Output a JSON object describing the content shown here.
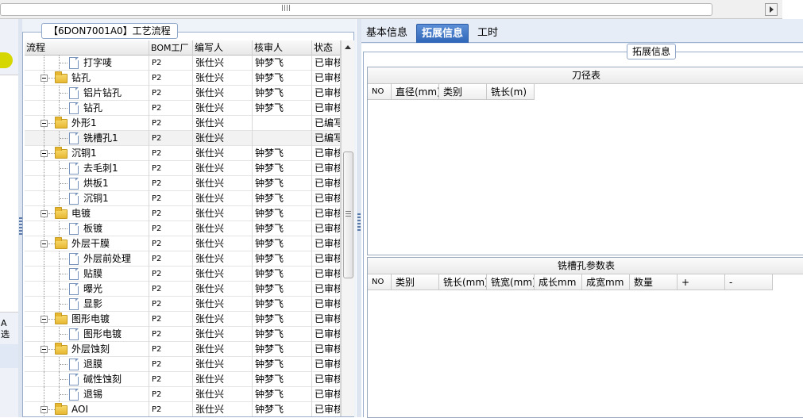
{
  "tree_panel": {
    "title": "【6DON7001A0】工艺流程",
    "columns": [
      "流程",
      "BOM工厂",
      "编写人",
      "核审人",
      "状态"
    ],
    "rows": [
      {
        "name": "打字唛",
        "level": 2,
        "node": "file",
        "bom": "P2",
        "writer": "张仕兴",
        "reviewer": "钟梦飞",
        "status": "已审核"
      },
      {
        "name": "钻孔",
        "level": 1,
        "node": "folder",
        "bom": "P2",
        "writer": "张仕兴",
        "reviewer": "钟梦飞",
        "status": "已审核"
      },
      {
        "name": "铝片钻孔",
        "level": 2,
        "node": "file",
        "bom": "P2",
        "writer": "张仕兴",
        "reviewer": "钟梦飞",
        "status": "已审核"
      },
      {
        "name": "钻孔",
        "level": 2,
        "node": "file",
        "bom": "P2",
        "writer": "张仕兴",
        "reviewer": "钟梦飞",
        "status": "已审核"
      },
      {
        "name": "外形1",
        "level": 1,
        "node": "folder",
        "bom": "P2",
        "writer": "张仕兴",
        "reviewer": "",
        "status": "已编写"
      },
      {
        "name": "铣槽孔1",
        "level": 2,
        "node": "file",
        "bom": "P2",
        "writer": "张仕兴",
        "reviewer": "",
        "status": "已编写",
        "selected": true
      },
      {
        "name": "沉铜1",
        "level": 1,
        "node": "folder",
        "bom": "P2",
        "writer": "张仕兴",
        "reviewer": "钟梦飞",
        "status": "已审核"
      },
      {
        "name": "去毛刺1",
        "level": 2,
        "node": "file",
        "bom": "P2",
        "writer": "张仕兴",
        "reviewer": "钟梦飞",
        "status": "已审核"
      },
      {
        "name": "烘板1",
        "level": 2,
        "node": "file",
        "bom": "P2",
        "writer": "张仕兴",
        "reviewer": "钟梦飞",
        "status": "已审核"
      },
      {
        "name": "沉铜1",
        "level": 2,
        "node": "file",
        "bom": "P2",
        "writer": "张仕兴",
        "reviewer": "钟梦飞",
        "status": "已审核"
      },
      {
        "name": "电镀",
        "level": 1,
        "node": "folder",
        "bom": "P2",
        "writer": "张仕兴",
        "reviewer": "钟梦飞",
        "status": "已审核"
      },
      {
        "name": "板镀",
        "level": 2,
        "node": "file",
        "bom": "P2",
        "writer": "张仕兴",
        "reviewer": "钟梦飞",
        "status": "已审核"
      },
      {
        "name": "外层干膜",
        "level": 1,
        "node": "folder",
        "bom": "P2",
        "writer": "张仕兴",
        "reviewer": "钟梦飞",
        "status": "已审核"
      },
      {
        "name": "外层前处理",
        "level": 2,
        "node": "file",
        "bom": "P2",
        "writer": "张仕兴",
        "reviewer": "钟梦飞",
        "status": "已审核"
      },
      {
        "name": "贴膜",
        "level": 2,
        "node": "file",
        "bom": "P2",
        "writer": "张仕兴",
        "reviewer": "钟梦飞",
        "status": "已审核"
      },
      {
        "name": "曝光",
        "level": 2,
        "node": "file",
        "bom": "P2",
        "writer": "张仕兴",
        "reviewer": "钟梦飞",
        "status": "已审核"
      },
      {
        "name": "显影",
        "level": 2,
        "node": "file",
        "bom": "P2",
        "writer": "张仕兴",
        "reviewer": "钟梦飞",
        "status": "已审核"
      },
      {
        "name": "图形电镀",
        "level": 1,
        "node": "folder",
        "bom": "P2",
        "writer": "张仕兴",
        "reviewer": "钟梦飞",
        "status": "已审核"
      },
      {
        "name": "图形电镀",
        "level": 2,
        "node": "file",
        "bom": "P2",
        "writer": "张仕兴",
        "reviewer": "钟梦飞",
        "status": "已审核"
      },
      {
        "name": "外层蚀刻",
        "level": 1,
        "node": "folder",
        "bom": "P2",
        "writer": "张仕兴",
        "reviewer": "钟梦飞",
        "status": "已审核"
      },
      {
        "name": "退膜",
        "level": 2,
        "node": "file",
        "bom": "P2",
        "writer": "张仕兴",
        "reviewer": "钟梦飞",
        "status": "已审核"
      },
      {
        "name": "碱性蚀刻",
        "level": 2,
        "node": "file",
        "bom": "P2",
        "writer": "张仕兴",
        "reviewer": "钟梦飞",
        "status": "已审核"
      },
      {
        "name": "退锡",
        "level": 2,
        "node": "file",
        "bom": "P2",
        "writer": "张仕兴",
        "reviewer": "钟梦飞",
        "status": "已审核"
      },
      {
        "name": "AOI",
        "level": 1,
        "node": "folder",
        "bom": "P2",
        "writer": "张仕兴",
        "reviewer": "钟梦飞",
        "status": "已审核"
      }
    ]
  },
  "left_strip": {
    "cut_label": "A\n选"
  },
  "tabs": [
    {
      "label": "基本信息",
      "active": false
    },
    {
      "label": "拓展信息",
      "active": true
    },
    {
      "label": "工时",
      "active": false
    }
  ],
  "ext_panel": {
    "title": "拓展信息",
    "tool_table": {
      "caption": "刀径表",
      "columns": [
        "NO",
        "直径(mm)",
        "类别",
        "铣长(m)"
      ]
    },
    "slot_table": {
      "caption": "铣槽孔参数表",
      "columns": [
        "NO",
        "类别",
        "铣长(mm)",
        "铣宽(mm)",
        "成长mm",
        "成宽mm",
        "数量",
        "+",
        "-"
      ]
    }
  },
  "colors": {
    "accent_tab": "#2f66b8",
    "pill": "#d6d600",
    "folder": "#e7b731"
  }
}
